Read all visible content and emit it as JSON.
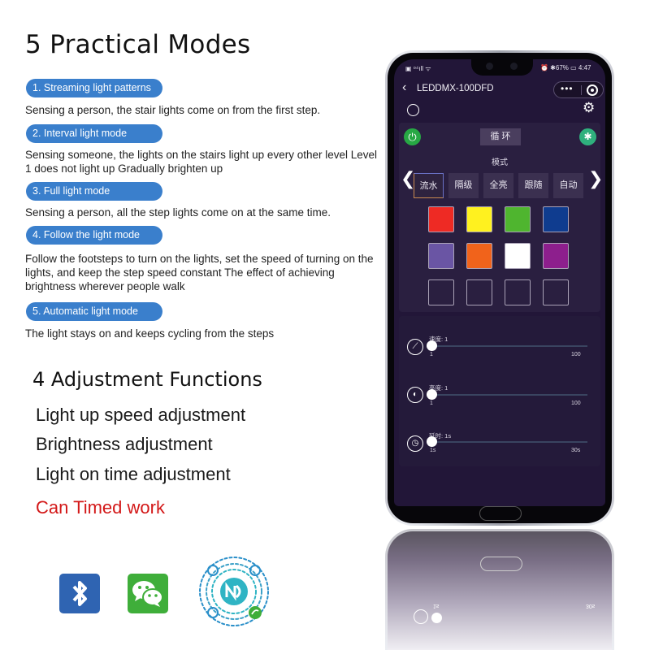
{
  "left": {
    "title": "5 Practical Modes",
    "modes": [
      {
        "label": "1. Streaming light patterns",
        "desc": "Sensing a person, the stair lights come on from the first step."
      },
      {
        "label": "2. Interval light mode",
        "desc": "Sensing someone, the lights on the stairs light up every other level Level 1 does not light up Gradually brighten up"
      },
      {
        "label": "3. Full light mode",
        "desc": "Sensing a person, all the step lights come on at the same time."
      },
      {
        "label": "4. Follow the light mode",
        "desc": "Follow the footsteps to turn on the lights, set the speed of turning on the lights, and keep the step speed constant The effect of achieving brightness wherever people walk"
      },
      {
        "label": "5. Automatic light mode",
        "desc": "The light stays on and keeps cycling from the steps"
      }
    ],
    "adjust_title": "4 Adjustment Functions",
    "adjustments": [
      "Light up speed adjustment",
      "Brightness adjustment",
      "Light on time adjustment",
      "Can Timed work"
    ],
    "highlight_color": "#d31818"
  },
  "bottom_icons": [
    "bluetooth-icon",
    "wechat-icon",
    "mini-program-qr-code"
  ],
  "phone": {
    "status": {
      "left": "▣ ᵒ⁴ıll ᯤ",
      "right": "⏰ ✱67% ▭ 4:47"
    },
    "app_title": "LEDDMX-100DFD",
    "capsule_dots": "•••",
    "loop_button": "循 环",
    "mode_label": "模式",
    "mode_tabs": [
      "流水",
      "隔级",
      "全亮",
      "跟随",
      "自动"
    ],
    "active_mode": 0,
    "swatches": [
      "#ee2a24",
      "#fff11f",
      "#4fb52f",
      "#0f3c8f",
      "#6a55a4",
      "#f1631b",
      "#ffffff",
      "#8d1f8d",
      "",
      "",
      "",
      ""
    ],
    "sliders": [
      {
        "label": "速度: 1",
        "min": "1",
        "max": "100",
        "value": 1,
        "icon": "speedometer-icon"
      },
      {
        "label": "亮度: 1",
        "min": "1",
        "max": "100",
        "value": 1,
        "icon": "brightness-icon"
      },
      {
        "label": "延时: 1s",
        "min": "1s",
        "max": "30s",
        "value": 1,
        "icon": "clock-icon"
      }
    ],
    "reflection": {
      "min": "1s",
      "max": "30s"
    }
  }
}
